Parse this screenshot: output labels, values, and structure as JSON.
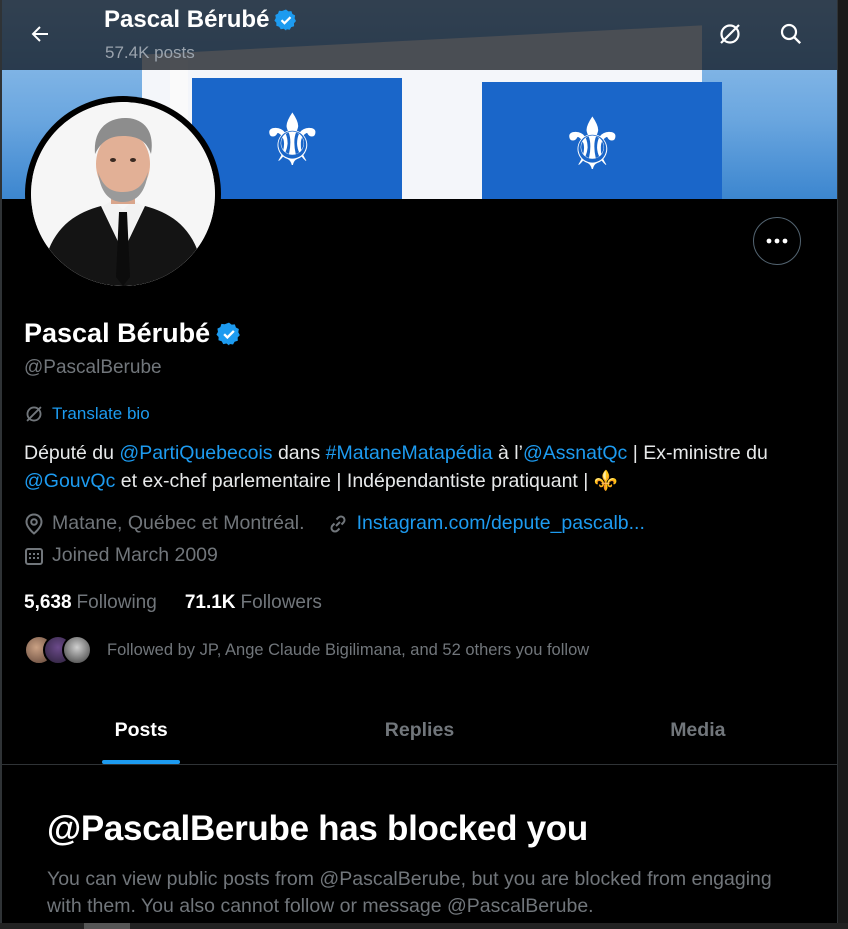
{
  "colors": {
    "accent": "#1d9bf0",
    "background": "#000000",
    "muted_text": "#71767b",
    "flag_blue": "#1a66c9"
  },
  "header": {
    "name": "Pascal Bérubé",
    "posts_count": "57.4K posts",
    "back_icon": "arrow-left-icon",
    "translate_icon": "translate-off-icon",
    "search_icon": "search-icon"
  },
  "banner": {
    "fleur": "⚜"
  },
  "profile": {
    "name": "Pascal Bérubé",
    "handle": "@PascalBerube",
    "verified_icon": "verified-badge-icon",
    "more_icon": "more-icon",
    "translate_bio": "Translate bio",
    "bio": {
      "t1": "Député du ",
      "l1": "@PartiQuebecois",
      "t2": " dans ",
      "l2": "#MataneMatapédia",
      "t3": " à l’",
      "l3": "@AssnatQc",
      "t4": " | Ex-ministre du ",
      "l4": "@GouvQc",
      "t5": " et ex-chef parlementaire | Indépendantiste pratiquant | ",
      "emoji": "⚜️"
    },
    "location": "Matane, Québec et Montréal.",
    "website": "Instagram.com/depute_pascalb...",
    "joined": "Joined March 2009",
    "following_count": "5,638",
    "following_label": "Following",
    "followers_count": "71.1K",
    "followers_label": "Followers",
    "followed_by": "Followed by JP, Ange Claude Bigilimana, and 52 others you follow"
  },
  "tabs": [
    {
      "label": "Posts",
      "active": true
    },
    {
      "label": "Replies",
      "active": false
    },
    {
      "label": "Media",
      "active": false
    }
  ],
  "blocked": {
    "title": "@PascalBerube has blocked you",
    "message": "You can view public posts from @PascalBerube, but you are blocked from engaging with them. You also cannot follow or message @PascalBerube."
  }
}
